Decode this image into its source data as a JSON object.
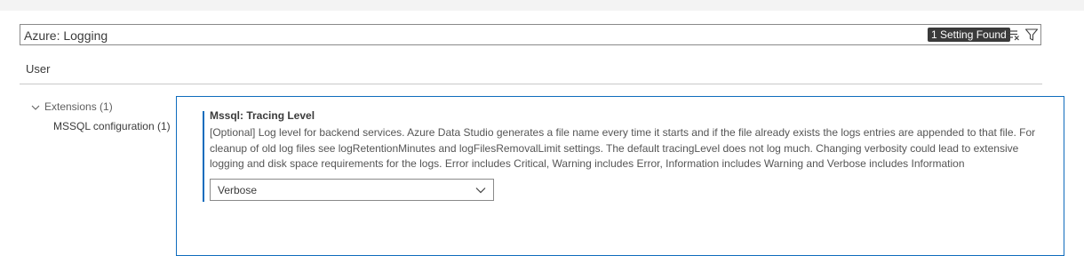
{
  "search": {
    "value": "Azure: Logging",
    "result_count": "1 Setting Found"
  },
  "tabs": {
    "user": "User"
  },
  "toc": {
    "extensions": "Extensions (1)",
    "mssql_configuration": "MSSQL configuration (1)"
  },
  "setting": {
    "title": "Mssql: Tracing Level",
    "description": "[Optional] Log level for backend services. Azure Data Studio generates a file name every time it starts and if the file already exists the logs entries are appended to that file. For cleanup of old log files see logRetentionMinutes and logFilesRemovalLimit settings. The default tracingLevel does not log much. Changing verbosity could lead to extensive logging and disk space requirements for the logs. Error includes Critical, Warning includes Error, Information includes Warning and Verbose includes Information",
    "selected_value": "Verbose"
  },
  "icons": {
    "clear_filter": "clear-filter-icon",
    "filter": "filter-icon",
    "tree_chevron": "chevron-down-icon",
    "select_chevron": "chevron-down-icon"
  },
  "colors": {
    "accent": "#0f6cbd",
    "badge_bg": "#3a3a3a"
  }
}
